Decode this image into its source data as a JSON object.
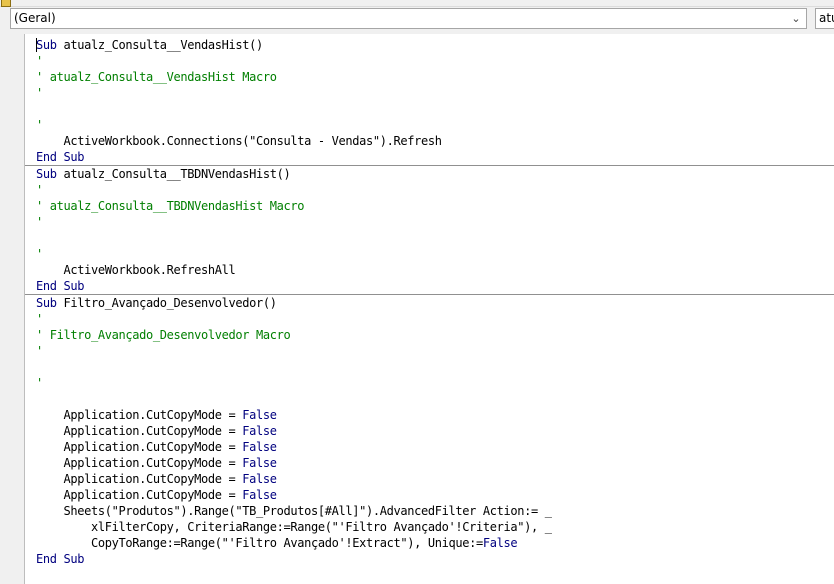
{
  "toolbar": {
    "object_combo": "(Geral)",
    "procedure_combo": "atualz_Consulta__VendasHist"
  },
  "code": {
    "procedures": [
      {
        "lines": [
          [
            {
              "t": "kw",
              "s": "Sub"
            },
            {
              "t": "tx",
              "s": " atualz_Consulta__VendasHist()"
            }
          ],
          [
            {
              "t": "cm",
              "s": "'"
            }
          ],
          [
            {
              "t": "cm",
              "s": "' atualz_Consulta__VendasHist Macro"
            }
          ],
          [
            {
              "t": "cm",
              "s": "'"
            }
          ],
          [],
          [
            {
              "t": "cm",
              "s": "'"
            }
          ],
          [
            {
              "t": "tx",
              "s": "    ActiveWorkbook.Connections(\"Consulta - Vendas\").Refresh"
            }
          ],
          [
            {
              "t": "kw",
              "s": "End Sub"
            }
          ]
        ]
      },
      {
        "lines": [
          [
            {
              "t": "kw",
              "s": "Sub"
            },
            {
              "t": "tx",
              "s": " atualz_Consulta__TBDNVendasHist()"
            }
          ],
          [
            {
              "t": "cm",
              "s": "'"
            }
          ],
          [
            {
              "t": "cm",
              "s": "' atualz_Consulta__TBDNVendasHist Macro"
            }
          ],
          [
            {
              "t": "cm",
              "s": "'"
            }
          ],
          [],
          [
            {
              "t": "cm",
              "s": "'"
            }
          ],
          [
            {
              "t": "tx",
              "s": "    ActiveWorkbook.RefreshAll"
            }
          ],
          [
            {
              "t": "kw",
              "s": "End Sub"
            }
          ]
        ]
      },
      {
        "lines": [
          [
            {
              "t": "kw",
              "s": "Sub"
            },
            {
              "t": "tx",
              "s": " Filtro_Avançado_Desenvolvedor()"
            }
          ],
          [
            {
              "t": "cm",
              "s": "'"
            }
          ],
          [
            {
              "t": "cm",
              "s": "' Filtro_Avançado_Desenvolvedor Macro"
            }
          ],
          [
            {
              "t": "cm",
              "s": "'"
            }
          ],
          [],
          [
            {
              "t": "cm",
              "s": "'"
            }
          ],
          [],
          [
            {
              "t": "tx",
              "s": "    Application.CutCopyMode = "
            },
            {
              "t": "kw",
              "s": "False"
            }
          ],
          [
            {
              "t": "tx",
              "s": "    Application.CutCopyMode = "
            },
            {
              "t": "kw",
              "s": "False"
            }
          ],
          [
            {
              "t": "tx",
              "s": "    Application.CutCopyMode = "
            },
            {
              "t": "kw",
              "s": "False"
            }
          ],
          [
            {
              "t": "tx",
              "s": "    Application.CutCopyMode = "
            },
            {
              "t": "kw",
              "s": "False"
            }
          ],
          [
            {
              "t": "tx",
              "s": "    Application.CutCopyMode = "
            },
            {
              "t": "kw",
              "s": "False"
            }
          ],
          [
            {
              "t": "tx",
              "s": "    Application.CutCopyMode = "
            },
            {
              "t": "kw",
              "s": "False"
            }
          ],
          [
            {
              "t": "tx",
              "s": "    Sheets(\"Produtos\").Range(\"TB_Produtos[#All]\").AdvancedFilter Action:= _"
            }
          ],
          [
            {
              "t": "tx",
              "s": "        xlFilterCopy, CriteriaRange:=Range(\"'Filtro Avançado'!Criteria\"), _"
            }
          ],
          [
            {
              "t": "tx",
              "s": "        CopyToRange:=Range(\"'Filtro Avançado'!Extract\"), Unique:="
            },
            {
              "t": "kw",
              "s": "False"
            }
          ],
          [
            {
              "t": "kw",
              "s": "End Sub"
            }
          ]
        ]
      }
    ]
  },
  "colors": {
    "keyword": "#00007f",
    "comment": "#007f00",
    "text": "#000000"
  }
}
